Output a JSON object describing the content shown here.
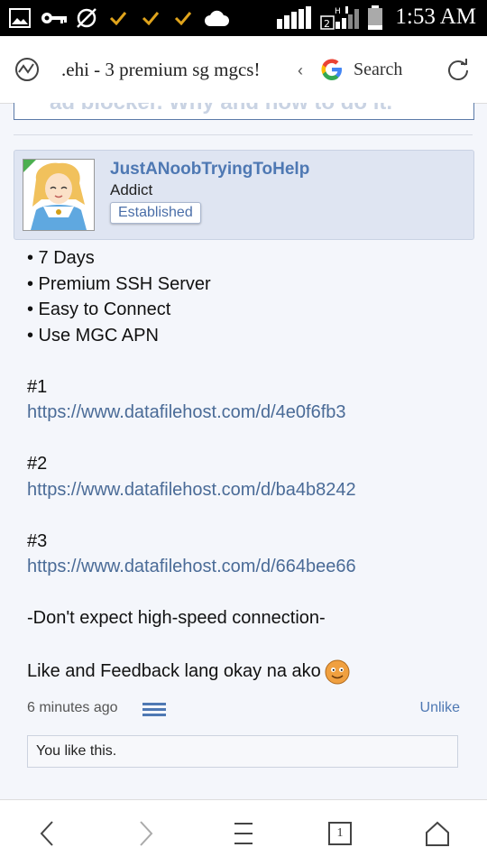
{
  "status_bar": {
    "time": "1:53 AM",
    "icons": [
      "image-icon",
      "key-icon",
      "data-saver-icon",
      "check-icon",
      "check-icon",
      "check-icon",
      "cloud-icon",
      "signal-icon",
      "sim2-signal-icon",
      "battery-icon"
    ],
    "sim_label": "2",
    "network_label": "H"
  },
  "url_bar": {
    "page_title": ".ehi - 3 premium sg mgcs!",
    "search_label": "Search",
    "left_icon": "chart-icon",
    "right_icon": "refresh-icon"
  },
  "previous_post": {
    "partial_text": "ad blocker. Why and how to do it."
  },
  "post": {
    "username": "JustANoobTryingToHelp",
    "user_title": "Addict",
    "badge": "Established",
    "body": {
      "features": [
        "• 7 Days",
        "• Premium SSH Server",
        "• Easy to Connect",
        "• Use MGC APN"
      ],
      "links": [
        {
          "label": "#1",
          "url": "https://www.datafilehost.com/d/4e0f6fb3"
        },
        {
          "label": "#2",
          "url": "https://www.datafilehost.com/d/ba4b8242"
        },
        {
          "label": "#3",
          "url": "https://www.datafilehost.com/d/664bee66"
        }
      ],
      "note": "-Don't expect high-speed connection-",
      "closing": "Like and Feedback lang okay na ako"
    },
    "timestamp": "6 minutes ago",
    "unlike_label": "Unlike",
    "likes_text": "You like this."
  },
  "bottom_nav": {
    "tab_count": "1",
    "items": [
      "back-icon",
      "forward-icon",
      "menu-icon",
      "tabs-icon",
      "home-icon"
    ]
  },
  "colors": {
    "link": "#4a6b97",
    "username": "#4e78b3",
    "user_block_bg": "#dfe5f2",
    "page_bg": "#f4f6fb"
  }
}
